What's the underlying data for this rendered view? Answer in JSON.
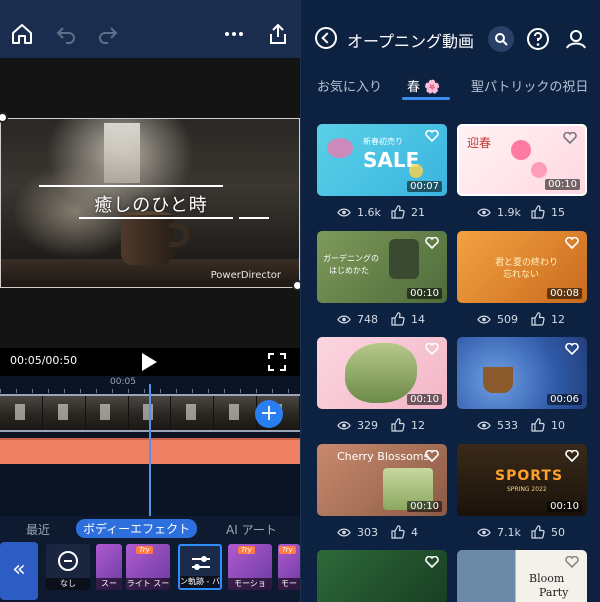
{
  "left": {
    "video_title": "癒しのひと時",
    "watermark": "PowerDirector",
    "time_display": "00:05/00:50",
    "ruler_mark": "00:05",
    "fx_tabs": [
      {
        "label": "最近",
        "active": false
      },
      {
        "label": "ボディーエフェクト",
        "active": true
      },
      {
        "label": "AI アート",
        "active": false
      }
    ],
    "fx_items": [
      {
        "label": "なし",
        "try": false
      },
      {
        "label": "スー",
        "try": false
      },
      {
        "label": "ライト スー",
        "try": true
      },
      {
        "label": "ン軌跡 - バ",
        "try": false
      },
      {
        "label": "モーショ",
        "try": true
      },
      {
        "label": "モー",
        "try": true
      }
    ],
    "try_badge": "Try"
  },
  "right": {
    "title": "オープニング動画",
    "tabs": [
      {
        "label": "お気に入り",
        "active": false
      },
      {
        "label": "春 🌸",
        "active": true
      },
      {
        "label": "聖パトリックの祝日",
        "active": false
      }
    ],
    "cards": [
      {
        "duration": "00:07",
        "views": "1.6k",
        "likes": "21",
        "caption": "SALE",
        "sub": "新春初売り"
      },
      {
        "duration": "00:10",
        "views": "1.9k",
        "likes": "15",
        "caption": "迎春",
        "sub": ""
      },
      {
        "duration": "00:10",
        "views": "748",
        "likes": "14",
        "caption": "ガーデニングの",
        "sub": "はじめかた"
      },
      {
        "duration": "00:08",
        "views": "509",
        "likes": "12",
        "caption": "君と夏の終わり",
        "sub": "忘れない"
      },
      {
        "duration": "00:10",
        "views": "329",
        "likes": "12",
        "caption": "",
        "sub": ""
      },
      {
        "duration": "00:06",
        "views": "533",
        "likes": "10",
        "caption": "",
        "sub": ""
      },
      {
        "duration": "00:10",
        "views": "303",
        "likes": "4",
        "caption": "Cherry Blossoms",
        "sub": ""
      },
      {
        "duration": "00:10",
        "views": "7.1k",
        "likes": "50",
        "caption": "SPORTS",
        "sub": "SPRING 2022"
      },
      {
        "duration": "",
        "views": "",
        "likes": "",
        "caption": "",
        "sub": ""
      },
      {
        "duration": "",
        "views": "",
        "likes": "",
        "caption": "Bloom",
        "sub": "Party"
      }
    ]
  },
  "colors": {
    "left_topbar": "#1a2d4f",
    "right_bg": "#0d2140",
    "accent_blue": "#2e6fde",
    "fx_track": "#f08064"
  },
  "icons": [
    "home-icon",
    "undo-icon",
    "redo-icon",
    "more-icon",
    "share-icon",
    "play-icon",
    "fullscreen-icon",
    "add-icon",
    "collapse-icon",
    "back-icon",
    "search-icon",
    "help-icon",
    "profile-icon",
    "heart-icon",
    "eye-icon",
    "thumbs-up-icon"
  ]
}
